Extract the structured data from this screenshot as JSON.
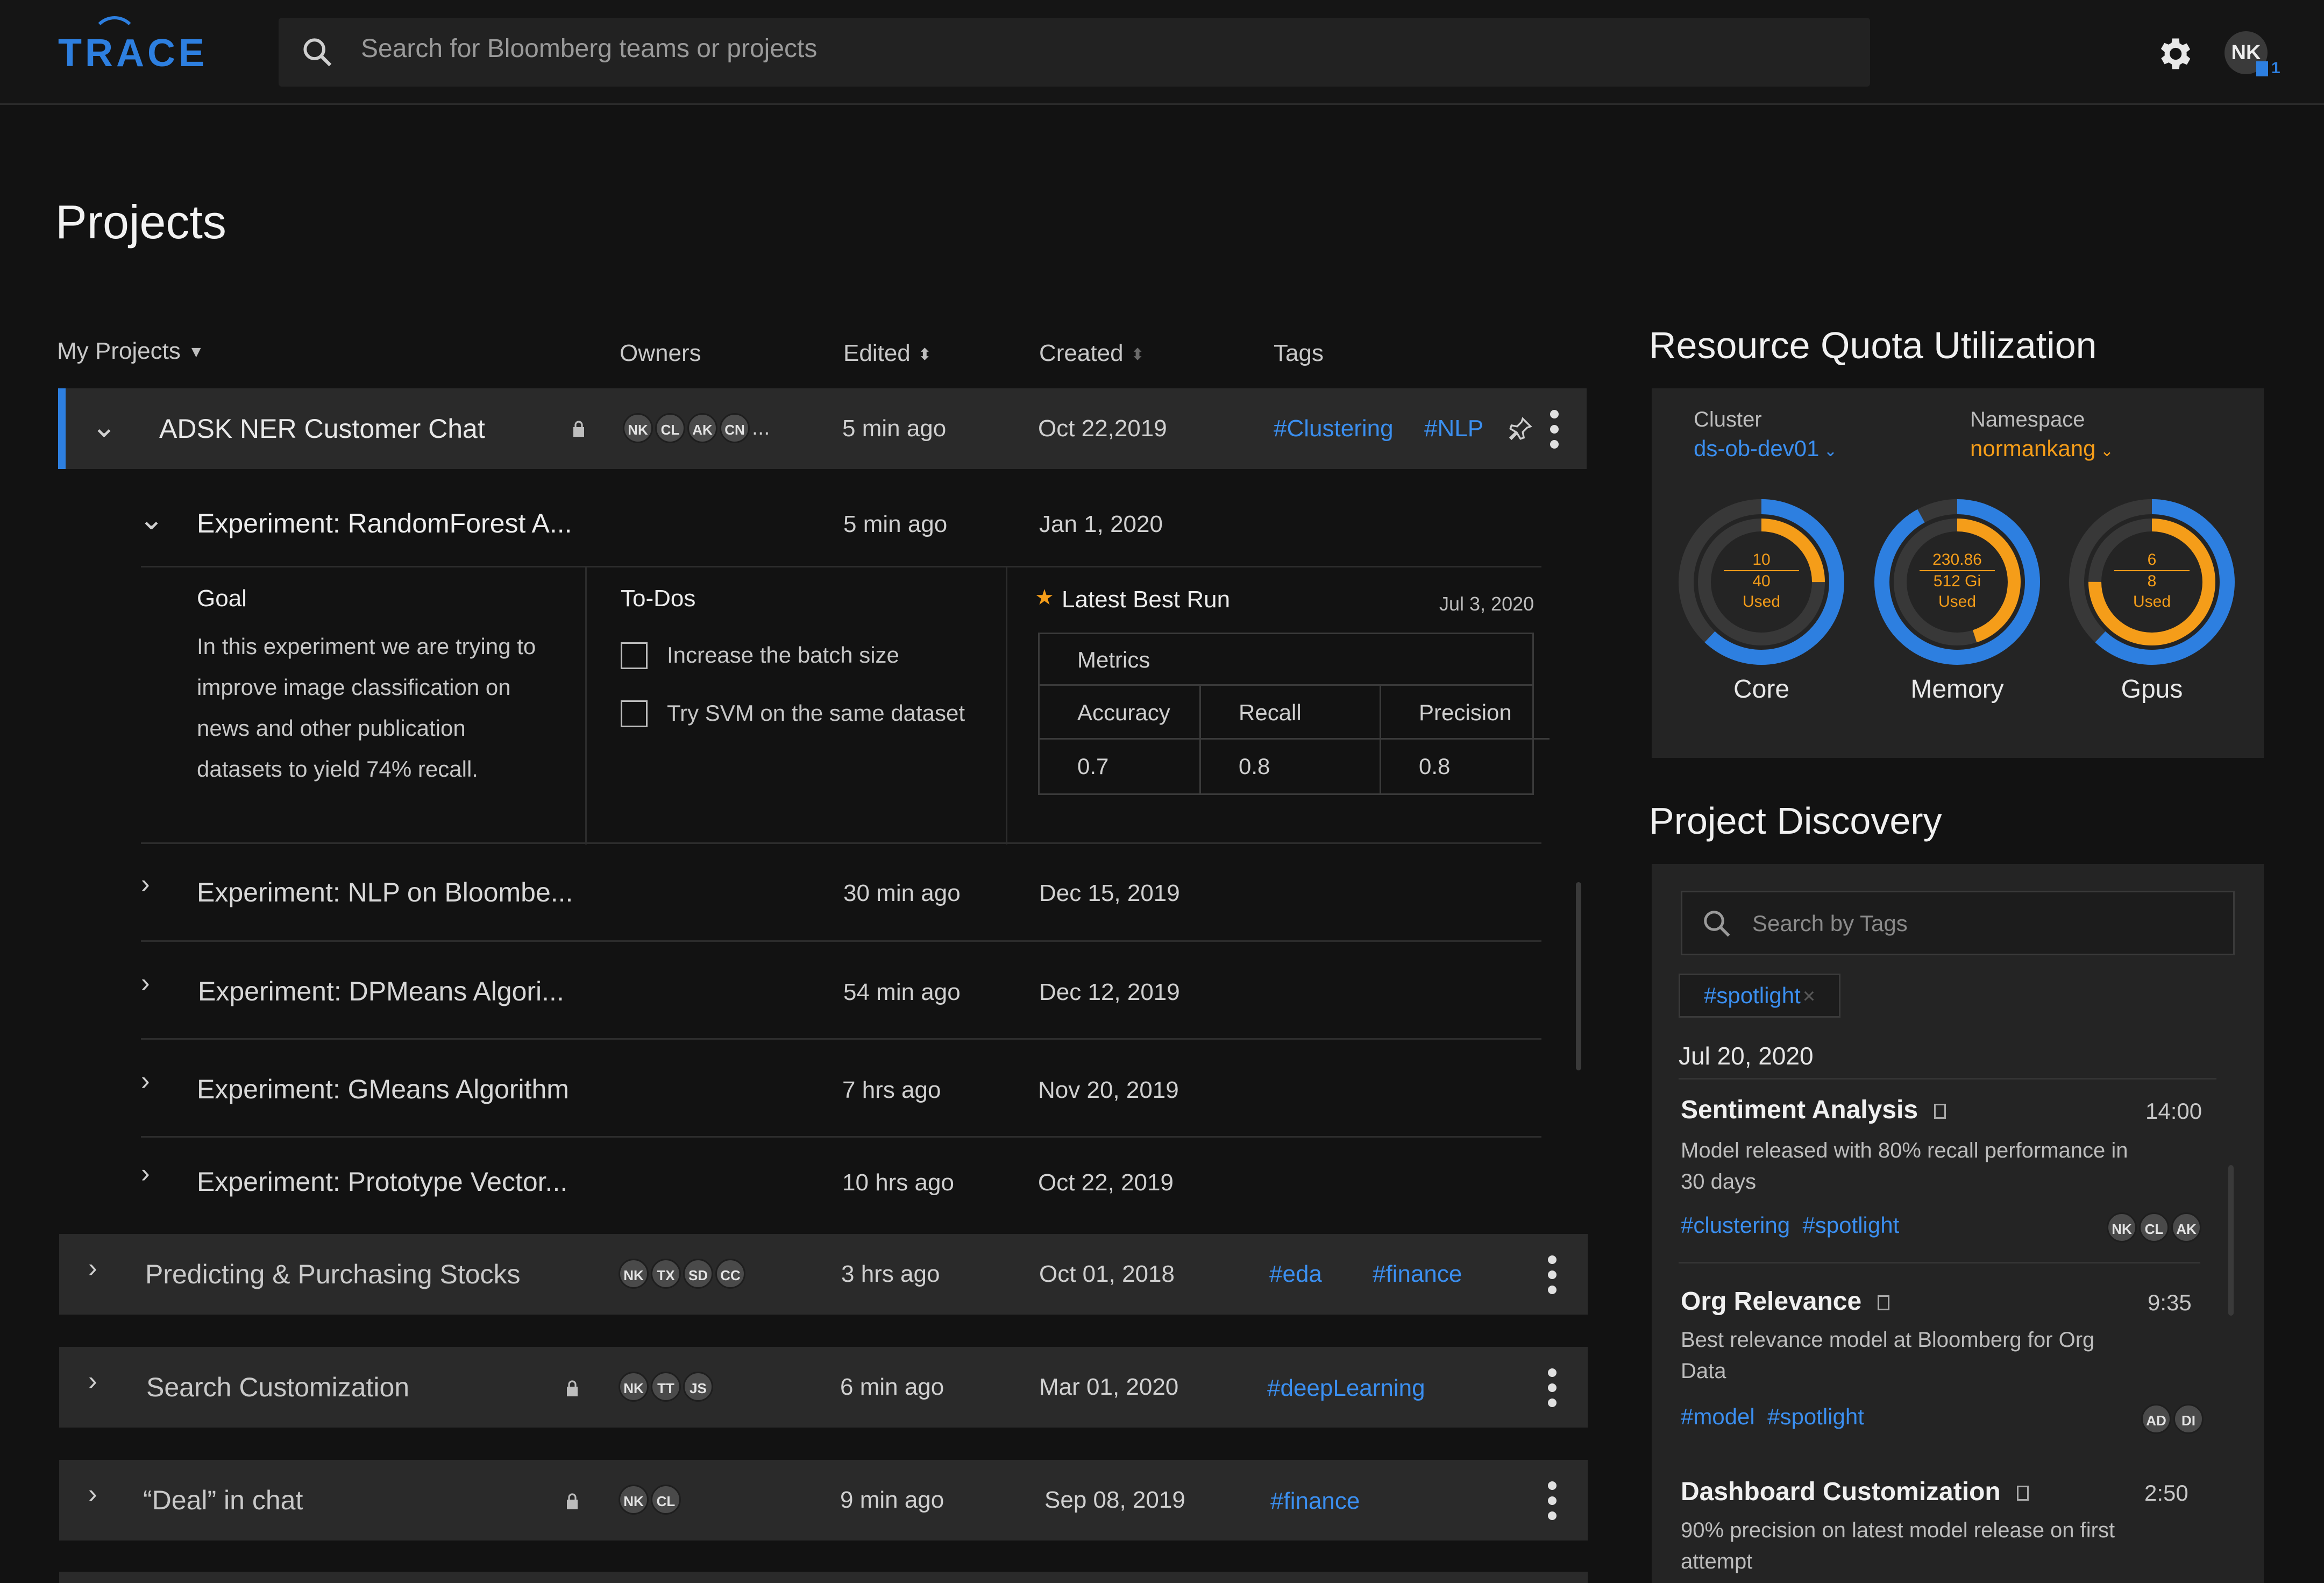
{
  "app": {
    "logo": "TRACE",
    "search_placeholder": "Search for Bloomberg teams or projects",
    "user_initials": "NK",
    "notification_count": "1"
  },
  "page": {
    "title": "Projects"
  },
  "columns": {
    "my_projects": "My Projects",
    "owners": "Owners",
    "edited": "Edited",
    "created": "Created",
    "tags": "Tags"
  },
  "projects": [
    {
      "name": "ADSK NER Customer Chat",
      "owners": [
        "NK",
        "CL",
        "AK",
        "CN"
      ],
      "owners_more": "...",
      "edited": "5 min ago",
      "created": "Oct 22,2019",
      "tags": [
        "#Clustering",
        "#NLP"
      ]
    },
    {
      "name": "Predicting & Purchasing Stocks",
      "owners": [
        "NK",
        "TX",
        "SD",
        "CC"
      ],
      "edited": "3 hrs ago",
      "created": "Oct 01, 2018",
      "tags": [
        "#eda",
        "#finance"
      ]
    },
    {
      "name": "Search Customization",
      "owners": [
        "NK",
        "TT",
        "JS"
      ],
      "edited": "6 min ago",
      "created": "Mar 01, 2020",
      "tags": [
        "#deepLearning"
      ]
    },
    {
      "name": "“Deal” in chat",
      "owners": [
        "NK",
        "CL"
      ],
      "edited": "9 min ago",
      "created": "Sep 08, 2019",
      "tags": [
        "#finance"
      ]
    }
  ],
  "experiments": [
    {
      "name": "Experiment: RandomForest A...",
      "edited": "5 min ago",
      "created": "Jan 1, 2020"
    },
    {
      "name": "Experiment: NLP on Bloombe...",
      "edited": "30 min ago",
      "created": "Dec 15, 2019"
    },
    {
      "name": "Experiment: DPMeans Algori...",
      "edited": "54 min ago",
      "created": "Dec 12, 2019"
    },
    {
      "name": "Experiment: GMeans Algorithm",
      "edited": "7 hrs ago",
      "created": "Nov 20, 2019"
    },
    {
      "name": "Experiment: Prototype Vector...",
      "edited": "10 hrs ago",
      "created": "Oct 22, 2019"
    }
  ],
  "detail": {
    "goal_title": "Goal",
    "goal_lines": [
      "In this experiment we are trying to",
      "improve image classification on",
      "news and other publication",
      "datasets to yield 74% recall."
    ],
    "todos_title": "To-Dos",
    "todos": [
      "Increase the batch size",
      "Try SVM on the same dataset"
    ],
    "best_run_title": "Latest Best Run",
    "best_run_date": "Jul 3, 2020",
    "metrics_title": "Metrics",
    "metric_headers": [
      "Accuracy",
      "Recall",
      "Precision"
    ],
    "metric_values": [
      "0.7",
      "0.8",
      "0.8"
    ]
  },
  "quota": {
    "title": "Resource Quota Utilization",
    "cluster_label": "Cluster",
    "cluster_value": "ds-ob-dev01",
    "namespace_label": "Namespace",
    "namespace_value": "normankang",
    "donuts": [
      {
        "label": "Core",
        "used": "10",
        "total": "40",
        "used_text": "Used",
        "outer_fraction": 0.62,
        "inner_fraction": 0.25
      },
      {
        "label": "Memory",
        "used": "230.86",
        "total": "512 Gi",
        "used_text": "Used",
        "outer_fraction": 0.92,
        "inner_fraction": 0.45
      },
      {
        "label": "Gpus",
        "used": "6",
        "total": "8",
        "used_text": "Used",
        "outer_fraction": 0.62,
        "inner_fraction": 0.75
      }
    ],
    "colors": {
      "outer": "#2d7fe0",
      "inner": "#f59d19",
      "track": "#383838"
    }
  },
  "discovery": {
    "title": "Project Discovery",
    "search_placeholder": "Search by Tags",
    "active_tag": "#spotlight",
    "date": "Jul 20, 2020",
    "cards": [
      {
        "title": "Sentiment Analysis",
        "time": "14:00",
        "desc_lines": [
          "Model released with 80% recall performance in",
          "30 days"
        ],
        "tags": [
          "#clustering",
          "#spotlight"
        ],
        "owners": [
          "NK",
          "CL",
          "AK"
        ]
      },
      {
        "title": "Org Relevance",
        "time": "9:35",
        "desc_lines": [
          "Best relevance model at Bloomberg for Org",
          "Data"
        ],
        "tags": [
          "#model",
          "#spotlight"
        ],
        "owners": [
          "AD",
          "DI"
        ]
      },
      {
        "title": "Dashboard Customization",
        "time": "2:50",
        "desc_lines": [
          "90% precision on latest model release on first",
          "attempt"
        ],
        "tags": [],
        "owners": []
      }
    ]
  }
}
